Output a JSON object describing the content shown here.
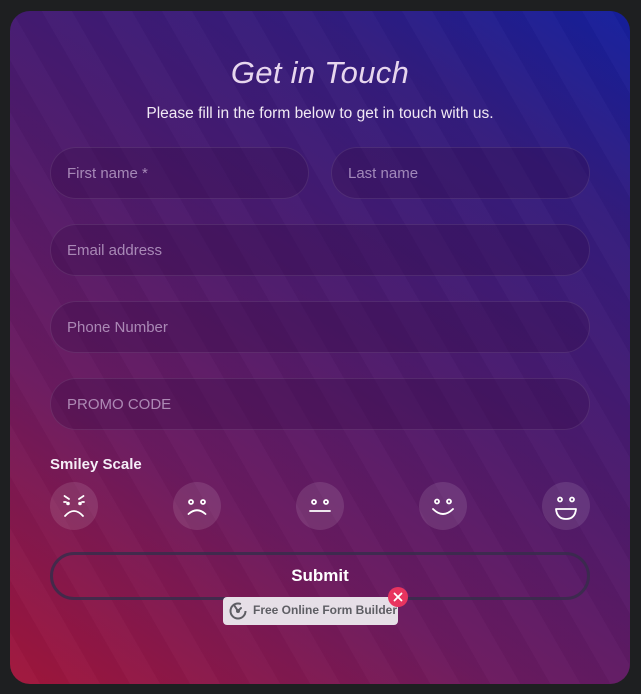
{
  "form": {
    "title": "Get in Touch",
    "subtitle": "Please fill in the form below to get in touch with us.",
    "fields": {
      "first_name": {
        "placeholder": "First name *",
        "value": ""
      },
      "last_name": {
        "placeholder": "Last name",
        "value": ""
      },
      "email": {
        "placeholder": "Email address",
        "value": ""
      },
      "phone": {
        "placeholder": "Phone Number",
        "value": ""
      },
      "promo": {
        "placeholder": "PROMO CODE",
        "value": ""
      }
    },
    "smiley_scale": {
      "label": "Smiley Scale",
      "options": [
        {
          "icon": "angry-face-icon"
        },
        {
          "icon": "sad-face-icon"
        },
        {
          "icon": "neutral-face-icon"
        },
        {
          "icon": "smile-face-icon"
        },
        {
          "icon": "grin-face-icon"
        }
      ]
    },
    "submit_label": "Submit"
  },
  "badge": {
    "text": "Free Online Form Builder",
    "icon": "form-builder-logo-icon",
    "close_icon": "close-icon"
  },
  "colors": {
    "page_background": "#1e1f21",
    "gradient_start": "#a1153a",
    "gradient_end": "#141f9d",
    "close_badge": "#e8345f",
    "badge_background": "#e6dfe7"
  }
}
